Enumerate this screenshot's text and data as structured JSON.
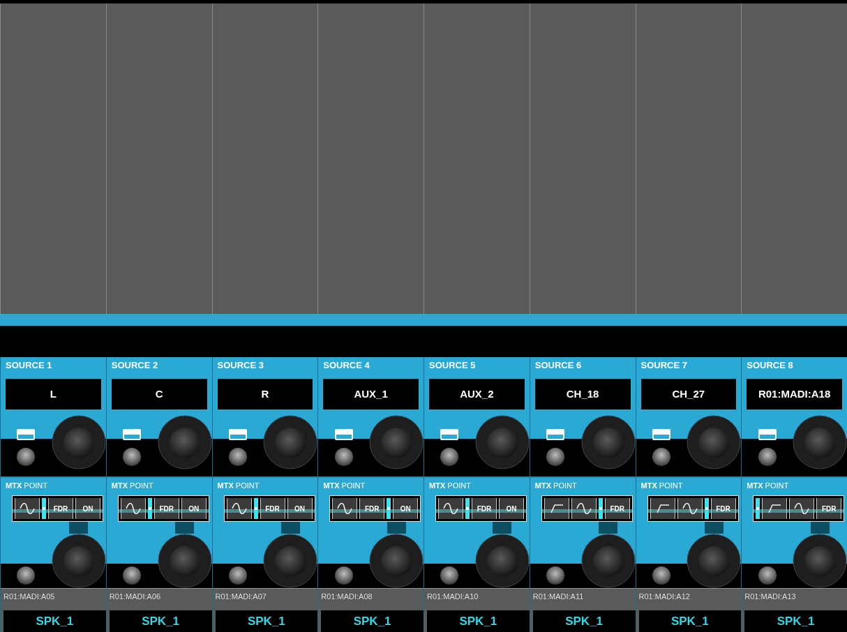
{
  "strips": [
    {
      "source_label": "SOURCE 1",
      "source": "L",
      "mtx_title": "**MTX** POINT",
      "chain": [
        {
          "kind": "eq"
        },
        {
          "kind": "point"
        },
        {
          "kind": "text",
          "label": "FDR"
        },
        {
          "kind": "text",
          "label": "ON"
        }
      ],
      "input": "R01:MADI:A05",
      "output": "SPK_1"
    },
    {
      "source_label": "SOURCE 2",
      "source": "C",
      "mtx_title": "**MTX** POINT",
      "chain": [
        {
          "kind": "eq"
        },
        {
          "kind": "point"
        },
        {
          "kind": "text",
          "label": "FDR"
        },
        {
          "kind": "text",
          "label": "ON"
        }
      ],
      "input": "R01:MADI:A06",
      "output": "SPK_1"
    },
    {
      "source_label": "SOURCE 3",
      "source": "R",
      "mtx_title": "**MTX** POINT",
      "chain": [
        {
          "kind": "eq"
        },
        {
          "kind": "point"
        },
        {
          "kind": "text",
          "label": "FDR"
        },
        {
          "kind": "text",
          "label": "ON"
        }
      ],
      "input": "R01:MADI:A07",
      "output": "SPK_1"
    },
    {
      "source_label": "SOURCE 4",
      "source": "AUX_1",
      "mtx_title": "**MTX** POINT",
      "chain": [
        {
          "kind": "eq"
        },
        {
          "kind": "text",
          "label": "FDR"
        },
        {
          "kind": "point"
        },
        {
          "kind": "text",
          "label": "ON"
        }
      ],
      "input": "R01:MADI:A08",
      "output": "SPK_1"
    },
    {
      "source_label": "SOURCE 5",
      "source": "AUX_2",
      "mtx_title": "**MTX** POINT",
      "chain": [
        {
          "kind": "eq"
        },
        {
          "kind": "point"
        },
        {
          "kind": "text",
          "label": "FDR"
        },
        {
          "kind": "text",
          "label": "ON"
        }
      ],
      "input": "R01:MADI:A10",
      "output": "SPK_1"
    },
    {
      "source_label": "SOURCE 6",
      "source": "CH_18",
      "mtx_title": "**MTX** POINT",
      "chain": [
        {
          "kind": "filter"
        },
        {
          "kind": "eq"
        },
        {
          "kind": "point"
        },
        {
          "kind": "text",
          "label": "FDR"
        }
      ],
      "input": "R01:MADI:A11",
      "output": "SPK_1"
    },
    {
      "source_label": "SOURCE 7",
      "source": "CH_27",
      "mtx_title": "**MTX** POINT",
      "chain": [
        {
          "kind": "filter"
        },
        {
          "kind": "eq"
        },
        {
          "kind": "point"
        },
        {
          "kind": "text",
          "label": "FDR"
        }
      ],
      "input": "R01:MADI:A12",
      "output": "SPK_1"
    },
    {
      "source_label": "SOURCE 8",
      "source": "R01:MADI:A18",
      "mtx_title": "**MTX** POINT",
      "chain": [
        {
          "kind": "point"
        },
        {
          "kind": "filter"
        },
        {
          "kind": "eq"
        },
        {
          "kind": "text",
          "label": "FDR"
        }
      ],
      "input": "R01:MADI:A13",
      "output": "SPK_1"
    }
  ]
}
